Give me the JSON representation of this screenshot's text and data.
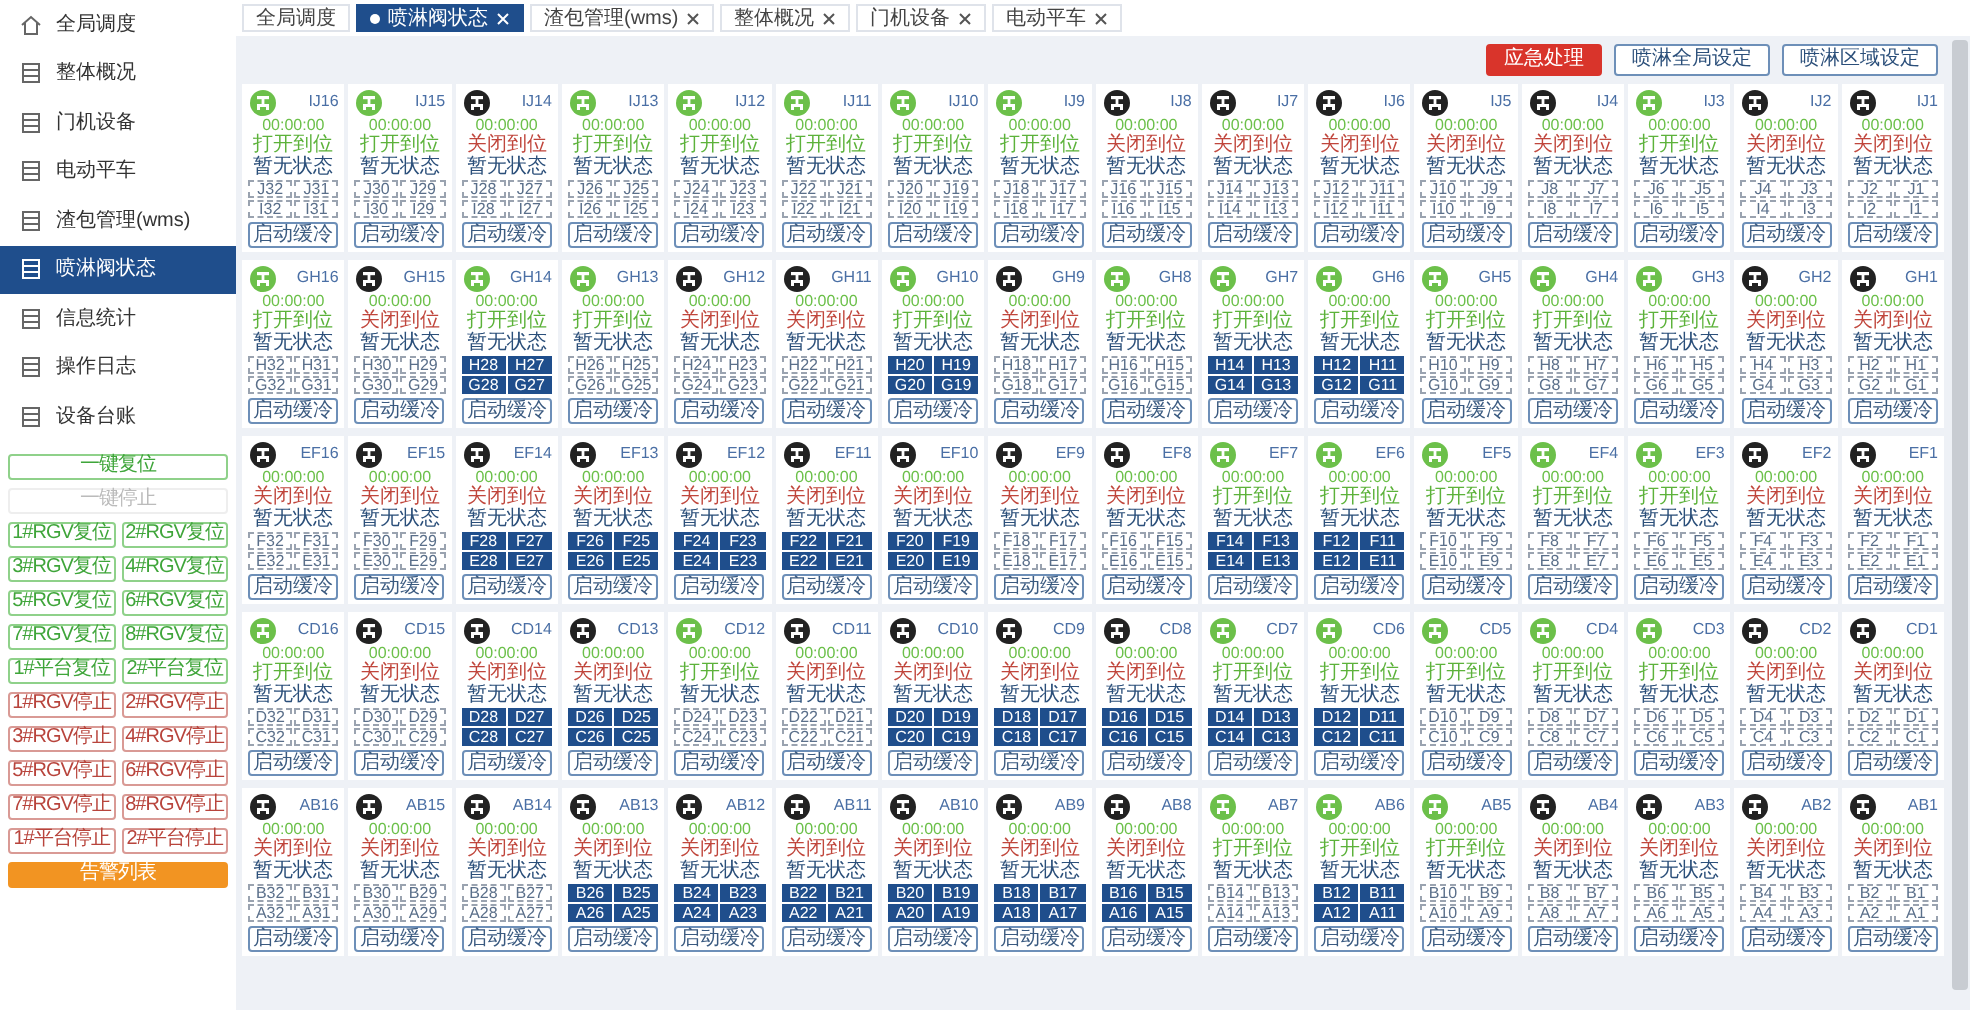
{
  "sidebar": {
    "menu": [
      {
        "label": "全局调度",
        "kind": "home",
        "selected": false
      },
      {
        "label": "整体概况",
        "kind": "page",
        "selected": false
      },
      {
        "label": "门机设备",
        "kind": "page",
        "selected": false
      },
      {
        "label": "电动平车",
        "kind": "page",
        "selected": false
      },
      {
        "label": "渣包管理(wms)",
        "kind": "page",
        "selected": false
      },
      {
        "label": "喷淋阀状态",
        "kind": "page",
        "selected": true
      },
      {
        "label": "信息统计",
        "kind": "page",
        "selected": false
      },
      {
        "label": "操作日志",
        "kind": "page",
        "selected": false
      },
      {
        "label": "设备台账",
        "kind": "page",
        "selected": false
      }
    ],
    "buttons": [
      {
        "label": "一键复位",
        "kind": "reset",
        "wide": true
      },
      {
        "label": "一键停止",
        "kind": "disabled",
        "wide": true
      },
      {
        "label": "1#RGV复位",
        "kind": "reset",
        "wide": false
      },
      {
        "label": "2#RGV复位",
        "kind": "reset",
        "wide": false
      },
      {
        "label": "3#RGV复位",
        "kind": "reset",
        "wide": false
      },
      {
        "label": "4#RGV复位",
        "kind": "reset",
        "wide": false
      },
      {
        "label": "5#RGV复位",
        "kind": "reset",
        "wide": false
      },
      {
        "label": "6#RGV复位",
        "kind": "reset",
        "wide": false
      },
      {
        "label": "7#RGV复位",
        "kind": "reset",
        "wide": false
      },
      {
        "label": "8#RGV复位",
        "kind": "reset",
        "wide": false
      },
      {
        "label": "1#平台复位",
        "kind": "reset",
        "wide": false
      },
      {
        "label": "2#平台复位",
        "kind": "reset",
        "wide": false
      },
      {
        "label": "1#RGV停止",
        "kind": "stop",
        "wide": false
      },
      {
        "label": "2#RGV停止",
        "kind": "stop",
        "wide": false
      },
      {
        "label": "3#RGV停止",
        "kind": "stop",
        "wide": false
      },
      {
        "label": "4#RGV停止",
        "kind": "stop",
        "wide": false
      },
      {
        "label": "5#RGV停止",
        "kind": "stop",
        "wide": false
      },
      {
        "label": "6#RGV停止",
        "kind": "stop",
        "wide": false
      },
      {
        "label": "7#RGV停止",
        "kind": "stop",
        "wide": false
      },
      {
        "label": "8#RGV停止",
        "kind": "stop",
        "wide": false
      },
      {
        "label": "1#平台停止",
        "kind": "stop",
        "wide": false
      },
      {
        "label": "2#平台停止",
        "kind": "stop",
        "wide": false
      },
      {
        "label": "告警列表",
        "kind": "alarm",
        "wide": true
      }
    ]
  },
  "tabs": [
    {
      "label": "全局调度",
      "selected": false,
      "closable": false
    },
    {
      "label": "喷淋阀状态",
      "selected": true,
      "closable": true
    },
    {
      "label": "渣包管理(wms)",
      "selected": false,
      "closable": true
    },
    {
      "label": "整体概况",
      "selected": false,
      "closable": true
    },
    {
      "label": "门机设备",
      "selected": false,
      "closable": true
    },
    {
      "label": "电动平车",
      "selected": false,
      "closable": true
    }
  ],
  "actions": [
    {
      "label": "应急处理",
      "kind": "danger"
    },
    {
      "label": "喷淋全局设定",
      "kind": "outline"
    },
    {
      "label": "喷淋区域设定",
      "kind": "outline"
    }
  ],
  "cards": [
    {
      "name": "IJ16",
      "time": "00:00:00",
      "status": "打开到位",
      "open": true,
      "state": "暂无状态",
      "cells": [
        "J32",
        "J31",
        "I32",
        "I31"
      ],
      "filled": false,
      "button": "启动缓冷"
    },
    {
      "name": "IJ15",
      "time": "00:00:00",
      "status": "打开到位",
      "open": true,
      "state": "暂无状态",
      "cells": [
        "J30",
        "J29",
        "I30",
        "I29"
      ],
      "filled": false,
      "button": "启动缓冷"
    },
    {
      "name": "IJ14",
      "time": "00:00:00",
      "status": "关闭到位",
      "open": false,
      "state": "暂无状态",
      "cells": [
        "J28",
        "J27",
        "I28",
        "I27"
      ],
      "filled": false,
      "button": "启动缓冷"
    },
    {
      "name": "IJ13",
      "time": "00:00:00",
      "status": "打开到位",
      "open": true,
      "state": "暂无状态",
      "cells": [
        "J26",
        "J25",
        "I26",
        "I25"
      ],
      "filled": false,
      "button": "启动缓冷"
    },
    {
      "name": "IJ12",
      "time": "00:00:00",
      "status": "打开到位",
      "open": true,
      "state": "暂无状态",
      "cells": [
        "J24",
        "J23",
        "I24",
        "I23"
      ],
      "filled": false,
      "button": "启动缓冷"
    },
    {
      "name": "IJ11",
      "time": "00:00:00",
      "status": "打开到位",
      "open": true,
      "state": "暂无状态",
      "cells": [
        "J22",
        "J21",
        "I22",
        "I21"
      ],
      "filled": false,
      "button": "启动缓冷"
    },
    {
      "name": "IJ10",
      "time": "00:00:00",
      "status": "打开到位",
      "open": true,
      "state": "暂无状态",
      "cells": [
        "J20",
        "J19",
        "I20",
        "I19"
      ],
      "filled": false,
      "button": "启动缓冷"
    },
    {
      "name": "IJ9",
      "time": "00:00:00",
      "status": "打开到位",
      "open": true,
      "state": "暂无状态",
      "cells": [
        "J18",
        "J17",
        "I18",
        "I17"
      ],
      "filled": false,
      "button": "启动缓冷"
    },
    {
      "name": "IJ8",
      "time": "00:00:00",
      "status": "关闭到位",
      "open": false,
      "state": "暂无状态",
      "cells": [
        "J16",
        "J15",
        "I16",
        "I15"
      ],
      "filled": false,
      "button": "启动缓冷"
    },
    {
      "name": "IJ7",
      "time": "00:00:00",
      "status": "关闭到位",
      "open": false,
      "state": "暂无状态",
      "cells": [
        "J14",
        "J13",
        "I14",
        "I13"
      ],
      "filled": false,
      "button": "启动缓冷"
    },
    {
      "name": "IJ6",
      "time": "00:00:00",
      "status": "关闭到位",
      "open": false,
      "state": "暂无状态",
      "cells": [
        "J12",
        "J11",
        "I12",
        "I11"
      ],
      "filled": false,
      "button": "启动缓冷"
    },
    {
      "name": "IJ5",
      "time": "00:00:00",
      "status": "关闭到位",
      "open": false,
      "state": "暂无状态",
      "cells": [
        "J10",
        "J9",
        "I10",
        "I9"
      ],
      "filled": false,
      "button": "启动缓冷"
    },
    {
      "name": "IJ4",
      "time": "00:00:00",
      "status": "关闭到位",
      "open": false,
      "state": "暂无状态",
      "cells": [
        "J8",
        "J7",
        "I8",
        "I7"
      ],
      "filled": false,
      "button": "启动缓冷"
    },
    {
      "name": "IJ3",
      "time": "00:00:00",
      "status": "打开到位",
      "open": true,
      "state": "暂无状态",
      "cells": [
        "J6",
        "J5",
        "I6",
        "I5"
      ],
      "filled": false,
      "button": "启动缓冷"
    },
    {
      "name": "IJ2",
      "time": "00:00:00",
      "status": "关闭到位",
      "open": false,
      "state": "暂无状态",
      "cells": [
        "J4",
        "J3",
        "I4",
        "I3"
      ],
      "filled": false,
      "button": "启动缓冷"
    },
    {
      "name": "IJ1",
      "time": "00:00:00",
      "status": "关闭到位",
      "open": false,
      "state": "暂无状态",
      "cells": [
        "J2",
        "J1",
        "I2",
        "I1"
      ],
      "filled": false,
      "button": "启动缓冷"
    },
    {
      "name": "GH16",
      "time": "00:00:00",
      "status": "打开到位",
      "open": true,
      "state": "暂无状态",
      "cells": [
        "H32",
        "H31",
        "G32",
        "G31"
      ],
      "filled": false,
      "button": "启动缓冷"
    },
    {
      "name": "GH15",
      "time": "00:00:00",
      "status": "关闭到位",
      "open": false,
      "state": "暂无状态",
      "cells": [
        "H30",
        "H29",
        "G30",
        "G29"
      ],
      "filled": false,
      "button": "启动缓冷"
    },
    {
      "name": "GH14",
      "time": "00:00:00",
      "status": "打开到位",
      "open": true,
      "state": "暂无状态",
      "cells": [
        "H28",
        "H27",
        "G28",
        "G27"
      ],
      "filled": true,
      "button": "启动缓冷"
    },
    {
      "name": "GH13",
      "time": "00:00:00",
      "status": "打开到位",
      "open": true,
      "state": "暂无状态",
      "cells": [
        "H26",
        "H25",
        "G26",
        "G25"
      ],
      "filled": false,
      "button": "启动缓冷"
    },
    {
      "name": "GH12",
      "time": "00:00:00",
      "status": "关闭到位",
      "open": false,
      "state": "暂无状态",
      "cells": [
        "H24",
        "H23",
        "G24",
        "G23"
      ],
      "filled": false,
      "button": "启动缓冷"
    },
    {
      "name": "GH11",
      "time": "00:00:00",
      "status": "关闭到位",
      "open": false,
      "state": "暂无状态",
      "cells": [
        "H22",
        "H21",
        "G22",
        "G21"
      ],
      "filled": false,
      "button": "启动缓冷"
    },
    {
      "name": "GH10",
      "time": "00:00:00",
      "status": "打开到位",
      "open": true,
      "state": "暂无状态",
      "cells": [
        "H20",
        "H19",
        "G20",
        "G19"
      ],
      "filled": true,
      "button": "启动缓冷"
    },
    {
      "name": "GH9",
      "time": "00:00:00",
      "status": "关闭到位",
      "open": false,
      "state": "暂无状态",
      "cells": [
        "H18",
        "H17",
        "G18",
        "G17"
      ],
      "filled": false,
      "button": "启动缓冷"
    },
    {
      "name": "GH8",
      "time": "00:00:00",
      "status": "打开到位",
      "open": true,
      "state": "暂无状态",
      "cells": [
        "H16",
        "H15",
        "G16",
        "G15"
      ],
      "filled": false,
      "button": "启动缓冷"
    },
    {
      "name": "GH7",
      "time": "00:00:00",
      "status": "打开到位",
      "open": true,
      "state": "暂无状态",
      "cells": [
        "H14",
        "H13",
        "G14",
        "G13"
      ],
      "filled": true,
      "button": "启动缓冷"
    },
    {
      "name": "GH6",
      "time": "00:00:00",
      "status": "打开到位",
      "open": true,
      "state": "暂无状态",
      "cells": [
        "H12",
        "H11",
        "G12",
        "G11"
      ],
      "filled": true,
      "button": "启动缓冷"
    },
    {
      "name": "GH5",
      "time": "00:00:00",
      "status": "打开到位",
      "open": true,
      "state": "暂无状态",
      "cells": [
        "H10",
        "H9",
        "G10",
        "G9"
      ],
      "filled": false,
      "button": "启动缓冷"
    },
    {
      "name": "GH4",
      "time": "00:00:00",
      "status": "打开到位",
      "open": true,
      "state": "暂无状态",
      "cells": [
        "H8",
        "H7",
        "G8",
        "G7"
      ],
      "filled": false,
      "button": "启动缓冷"
    },
    {
      "name": "GH3",
      "time": "00:00:00",
      "status": "打开到位",
      "open": true,
      "state": "暂无状态",
      "cells": [
        "H6",
        "H5",
        "G6",
        "G5"
      ],
      "filled": false,
      "button": "启动缓冷"
    },
    {
      "name": "GH2",
      "time": "00:00:00",
      "status": "关闭到位",
      "open": false,
      "state": "暂无状态",
      "cells": [
        "H4",
        "H3",
        "G4",
        "G3"
      ],
      "filled": false,
      "button": "启动缓冷"
    },
    {
      "name": "GH1",
      "time": "00:00:00",
      "status": "关闭到位",
      "open": false,
      "state": "暂无状态",
      "cells": [
        "H2",
        "H1",
        "G2",
        "G1"
      ],
      "filled": false,
      "button": "启动缓冷"
    },
    {
      "name": "EF16",
      "time": "00:00:00",
      "status": "关闭到位",
      "open": false,
      "state": "暂无状态",
      "cells": [
        "F32",
        "F31",
        "E32",
        "E31"
      ],
      "filled": false,
      "button": "启动缓冷"
    },
    {
      "name": "EF15",
      "time": "00:00:00",
      "status": "关闭到位",
      "open": false,
      "state": "暂无状态",
      "cells": [
        "F30",
        "F29",
        "E30",
        "E29"
      ],
      "filled": false,
      "button": "启动缓冷"
    },
    {
      "name": "EF14",
      "time": "00:00:00",
      "status": "关闭到位",
      "open": false,
      "state": "暂无状态",
      "cells": [
        "F28",
        "F27",
        "E28",
        "E27"
      ],
      "filled": true,
      "button": "启动缓冷"
    },
    {
      "name": "EF13",
      "time": "00:00:00",
      "status": "关闭到位",
      "open": false,
      "state": "暂无状态",
      "cells": [
        "F26",
        "F25",
        "E26",
        "E25"
      ],
      "filled": true,
      "button": "启动缓冷"
    },
    {
      "name": "EF12",
      "time": "00:00:00",
      "status": "关闭到位",
      "open": false,
      "state": "暂无状态",
      "cells": [
        "F24",
        "F23",
        "E24",
        "E23"
      ],
      "filled": true,
      "button": "启动缓冷"
    },
    {
      "name": "EF11",
      "time": "00:00:00",
      "status": "关闭到位",
      "open": false,
      "state": "暂无状态",
      "cells": [
        "F22",
        "F21",
        "E22",
        "E21"
      ],
      "filled": true,
      "button": "启动缓冷"
    },
    {
      "name": "EF10",
      "time": "00:00:00",
      "status": "关闭到位",
      "open": false,
      "state": "暂无状态",
      "cells": [
        "F20",
        "F19",
        "E20",
        "E19"
      ],
      "filled": true,
      "button": "启动缓冷"
    },
    {
      "name": "EF9",
      "time": "00:00:00",
      "status": "关闭到位",
      "open": false,
      "state": "暂无状态",
      "cells": [
        "F18",
        "F17",
        "E18",
        "E17"
      ],
      "filled": false,
      "button": "启动缓冷"
    },
    {
      "name": "EF8",
      "time": "00:00:00",
      "status": "关闭到位",
      "open": false,
      "state": "暂无状态",
      "cells": [
        "F16",
        "F15",
        "E16",
        "E15"
      ],
      "filled": false,
      "button": "启动缓冷"
    },
    {
      "name": "EF7",
      "time": "00:00:00",
      "status": "打开到位",
      "open": true,
      "state": "暂无状态",
      "cells": [
        "F14",
        "F13",
        "E14",
        "E13"
      ],
      "filled": true,
      "button": "启动缓冷"
    },
    {
      "name": "EF6",
      "time": "00:00:00",
      "status": "打开到位",
      "open": true,
      "state": "暂无状态",
      "cells": [
        "F12",
        "F11",
        "E12",
        "E11"
      ],
      "filled": true,
      "button": "启动缓冷"
    },
    {
      "name": "EF5",
      "time": "00:00:00",
      "status": "打开到位",
      "open": true,
      "state": "暂无状态",
      "cells": [
        "F10",
        "F9",
        "E10",
        "E9"
      ],
      "filled": false,
      "button": "启动缓冷"
    },
    {
      "name": "EF4",
      "time": "00:00:00",
      "status": "打开到位",
      "open": true,
      "state": "暂无状态",
      "cells": [
        "F8",
        "F7",
        "E8",
        "E7"
      ],
      "filled": false,
      "button": "启动缓冷"
    },
    {
      "name": "EF3",
      "time": "00:00:00",
      "status": "打开到位",
      "open": true,
      "state": "暂无状态",
      "cells": [
        "F6",
        "F5",
        "E6",
        "E5"
      ],
      "filled": false,
      "button": "启动缓冷"
    },
    {
      "name": "EF2",
      "time": "00:00:00",
      "status": "关闭到位",
      "open": false,
      "state": "暂无状态",
      "cells": [
        "F4",
        "F3",
        "E4",
        "E3"
      ],
      "filled": false,
      "button": "启动缓冷"
    },
    {
      "name": "EF1",
      "time": "00:00:00",
      "status": "关闭到位",
      "open": false,
      "state": "暂无状态",
      "cells": [
        "F2",
        "F1",
        "E2",
        "E1"
      ],
      "filled": false,
      "button": "启动缓冷"
    },
    {
      "name": "CD16",
      "time": "00:00:00",
      "status": "打开到位",
      "open": true,
      "state": "暂无状态",
      "cells": [
        "D32",
        "D31",
        "C32",
        "C31"
      ],
      "filled": false,
      "button": "启动缓冷"
    },
    {
      "name": "CD15",
      "time": "00:00:00",
      "status": "关闭到位",
      "open": false,
      "state": "暂无状态",
      "cells": [
        "D30",
        "D29",
        "C30",
        "C29"
      ],
      "filled": false,
      "button": "启动缓冷"
    },
    {
      "name": "CD14",
      "time": "00:00:00",
      "status": "关闭到位",
      "open": false,
      "state": "暂无状态",
      "cells": [
        "D28",
        "D27",
        "C28",
        "C27"
      ],
      "filled": true,
      "button": "启动缓冷"
    },
    {
      "name": "CD13",
      "time": "00:00:00",
      "status": "关闭到位",
      "open": false,
      "state": "暂无状态",
      "cells": [
        "D26",
        "D25",
        "C26",
        "C25"
      ],
      "filled": true,
      "button": "启动缓冷"
    },
    {
      "name": "CD12",
      "time": "00:00:00",
      "status": "打开到位",
      "open": true,
      "state": "暂无状态",
      "cells": [
        "D24",
        "D23",
        "C24",
        "C23"
      ],
      "filled": false,
      "button": "启动缓冷"
    },
    {
      "name": "CD11",
      "time": "00:00:00",
      "status": "关闭到位",
      "open": false,
      "state": "暂无状态",
      "cells": [
        "D22",
        "D21",
        "C22",
        "C21"
      ],
      "filled": false,
      "button": "启动缓冷"
    },
    {
      "name": "CD10",
      "time": "00:00:00",
      "status": "关闭到位",
      "open": false,
      "state": "暂无状态",
      "cells": [
        "D20",
        "D19",
        "C20",
        "C19"
      ],
      "filled": true,
      "button": "启动缓冷"
    },
    {
      "name": "CD9",
      "time": "00:00:00",
      "status": "关闭到位",
      "open": false,
      "state": "暂无状态",
      "cells": [
        "D18",
        "D17",
        "C18",
        "C17"
      ],
      "filled": true,
      "button": "启动缓冷"
    },
    {
      "name": "CD8",
      "time": "00:00:00",
      "status": "关闭到位",
      "open": false,
      "state": "暂无状态",
      "cells": [
        "D16",
        "D15",
        "C16",
        "C15"
      ],
      "filled": true,
      "button": "启动缓冷"
    },
    {
      "name": "CD7",
      "time": "00:00:00",
      "status": "打开到位",
      "open": true,
      "state": "暂无状态",
      "cells": [
        "D14",
        "D13",
        "C14",
        "C13"
      ],
      "filled": true,
      "button": "启动缓冷"
    },
    {
      "name": "CD6",
      "time": "00:00:00",
      "status": "打开到位",
      "open": true,
      "state": "暂无状态",
      "cells": [
        "D12",
        "D11",
        "C12",
        "C11"
      ],
      "filled": true,
      "button": "启动缓冷"
    },
    {
      "name": "CD5",
      "time": "00:00:00",
      "status": "打开到位",
      "open": true,
      "state": "暂无状态",
      "cells": [
        "D10",
        "D9",
        "C10",
        "C9"
      ],
      "filled": false,
      "button": "启动缓冷"
    },
    {
      "name": "CD4",
      "time": "00:00:00",
      "status": "打开到位",
      "open": true,
      "state": "暂无状态",
      "cells": [
        "D8",
        "D7",
        "C8",
        "C7"
      ],
      "filled": false,
      "button": "启动缓冷"
    },
    {
      "name": "CD3",
      "time": "00:00:00",
      "status": "打开到位",
      "open": true,
      "state": "暂无状态",
      "cells": [
        "D6",
        "D5",
        "C6",
        "C5"
      ],
      "filled": false,
      "button": "启动缓冷"
    },
    {
      "name": "CD2",
      "time": "00:00:00",
      "status": "关闭到位",
      "open": false,
      "state": "暂无状态",
      "cells": [
        "D4",
        "D3",
        "C4",
        "C3"
      ],
      "filled": false,
      "button": "启动缓冷"
    },
    {
      "name": "CD1",
      "time": "00:00:00",
      "status": "关闭到位",
      "open": false,
      "state": "暂无状态",
      "cells": [
        "D2",
        "D1",
        "C2",
        "C1"
      ],
      "filled": false,
      "button": "启动缓冷"
    },
    {
      "name": "AB16",
      "time": "00:00:00",
      "status": "关闭到位",
      "open": false,
      "state": "暂无状态",
      "cells": [
        "B32",
        "B31",
        "A32",
        "A31"
      ],
      "filled": false,
      "button": "启动缓冷"
    },
    {
      "name": "AB15",
      "time": "00:00:00",
      "status": "关闭到位",
      "open": false,
      "state": "暂无状态",
      "cells": [
        "B30",
        "B29",
        "A30",
        "A29"
      ],
      "filled": false,
      "button": "启动缓冷"
    },
    {
      "name": "AB14",
      "time": "00:00:00",
      "status": "关闭到位",
      "open": false,
      "state": "暂无状态",
      "cells": [
        "B28",
        "B27",
        "A28",
        "A27"
      ],
      "filled": false,
      "button": "启动缓冷"
    },
    {
      "name": "AB13",
      "time": "00:00:00",
      "status": "关闭到位",
      "open": false,
      "state": "暂无状态",
      "cells": [
        "B26",
        "B25",
        "A26",
        "A25"
      ],
      "filled": true,
      "button": "启动缓冷"
    },
    {
      "name": "AB12",
      "time": "00:00:00",
      "status": "关闭到位",
      "open": false,
      "state": "暂无状态",
      "cells": [
        "B24",
        "B23",
        "A24",
        "A23"
      ],
      "filled": true,
      "button": "启动缓冷"
    },
    {
      "name": "AB11",
      "time": "00:00:00",
      "status": "关闭到位",
      "open": false,
      "state": "暂无状态",
      "cells": [
        "B22",
        "B21",
        "A22",
        "A21"
      ],
      "filled": true,
      "button": "启动缓冷"
    },
    {
      "name": "AB10",
      "time": "00:00:00",
      "status": "关闭到位",
      "open": false,
      "state": "暂无状态",
      "cells": [
        "B20",
        "B19",
        "A20",
        "A19"
      ],
      "filled": true,
      "button": "启动缓冷"
    },
    {
      "name": "AB9",
      "time": "00:00:00",
      "status": "关闭到位",
      "open": false,
      "state": "暂无状态",
      "cells": [
        "B18",
        "B17",
        "A18",
        "A17"
      ],
      "filled": true,
      "button": "启动缓冷"
    },
    {
      "name": "AB8",
      "time": "00:00:00",
      "status": "关闭到位",
      "open": false,
      "state": "暂无状态",
      "cells": [
        "B16",
        "B15",
        "A16",
        "A15"
      ],
      "filled": true,
      "button": "启动缓冷"
    },
    {
      "name": "AB7",
      "time": "00:00:00",
      "status": "打开到位",
      "open": true,
      "state": "暂无状态",
      "cells": [
        "B14",
        "B13",
        "A14",
        "A13"
      ],
      "filled": false,
      "button": "启动缓冷"
    },
    {
      "name": "AB6",
      "time": "00:00:00",
      "status": "打开到位",
      "open": true,
      "state": "暂无状态",
      "cells": [
        "B12",
        "B11",
        "A12",
        "A11"
      ],
      "filled": true,
      "button": "启动缓冷"
    },
    {
      "name": "AB5",
      "time": "00:00:00",
      "status": "打开到位",
      "open": true,
      "state": "暂无状态",
      "cells": [
        "B10",
        "B9",
        "A10",
        "A9"
      ],
      "filled": false,
      "button": "启动缓冷"
    },
    {
      "name": "AB4",
      "time": "00:00:00",
      "status": "关闭到位",
      "open": false,
      "state": "暂无状态",
      "cells": [
        "B8",
        "B7",
        "A8",
        "A7"
      ],
      "filled": false,
      "button": "启动缓冷"
    },
    {
      "name": "AB3",
      "time": "00:00:00",
      "status": "关闭到位",
      "open": false,
      "state": "暂无状态",
      "cells": [
        "B6",
        "B5",
        "A6",
        "A5"
      ],
      "filled": false,
      "button": "启动缓冷"
    },
    {
      "name": "AB2",
      "time": "00:00:00",
      "status": "关闭到位",
      "open": false,
      "state": "暂无状态",
      "cells": [
        "B4",
        "B3",
        "A4",
        "A3"
      ],
      "filled": false,
      "button": "启动缓冷"
    },
    {
      "name": "AB1",
      "time": "00:00:00",
      "status": "关闭到位",
      "open": false,
      "state": "暂无状态",
      "cells": [
        "B2",
        "B1",
        "A2",
        "A1"
      ],
      "filled": false,
      "button": "启动缓冷"
    }
  ]
}
